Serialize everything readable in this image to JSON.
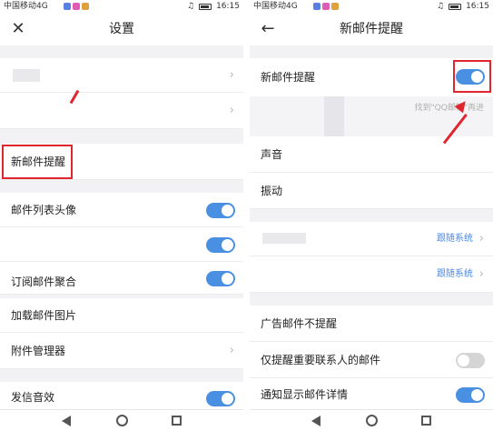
{
  "statusbar": {
    "carrier": "中国移动4G",
    "time": "16:15",
    "badge_colors": [
      "#5b7fe0",
      "#e05bb5",
      "#e0a03b"
    ]
  },
  "left": {
    "title": "设置",
    "close_icon": "close-icon",
    "rows": {
      "new_mail_alert": "新邮件提醒",
      "mail_list_avatar": "邮件列表头像",
      "subscription_partial": "订阅邮件聚合",
      "load_images": "加载邮件图片",
      "attachment_manager": "附件管理器",
      "send_sound": "发信音效"
    },
    "chevron": "›",
    "toggles": {
      "mail_list_avatar": true,
      "unlabeled_row": true,
      "subscription": true,
      "send_sound": true
    }
  },
  "right": {
    "title": "新邮件提醒",
    "back_icon": "arrow-left-icon",
    "rows": {
      "new_mail_alert": "新邮件提醒",
      "hint": "找到\"QQ邮箱\"再进",
      "sound": "声音",
      "vibration": "振动",
      "follow_system_1": "跟随系统",
      "follow_system_2": "跟随系统",
      "ad_no_alert": "广告邮件不提醒",
      "important_only": "仅提醒重要联系人的邮件",
      "show_details": "通知显示邮件详情"
    },
    "chevron": "›",
    "toggles": {
      "new_mail_alert": true,
      "important_only": false,
      "show_details": true
    }
  },
  "colors": {
    "accent": "#4a90e2",
    "highlight": "#e0252f",
    "link": "#4a88e8"
  }
}
